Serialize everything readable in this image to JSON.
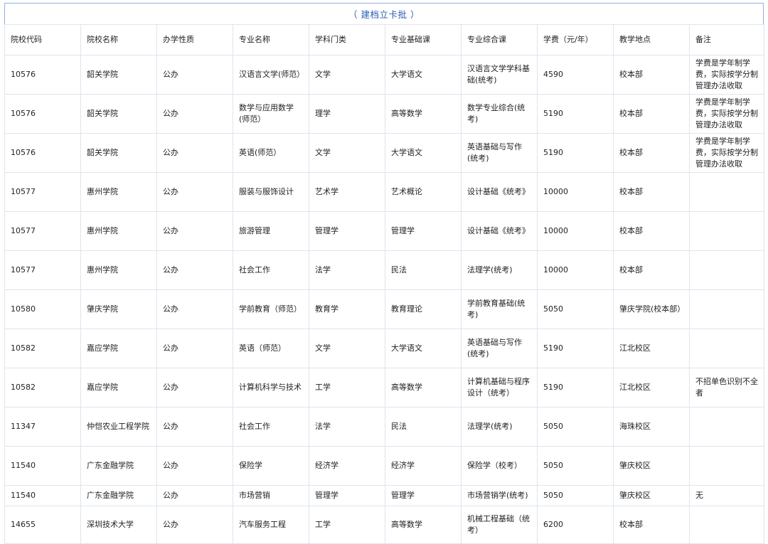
{
  "banner": "（ 建档立卡批 ）",
  "columns": [
    "院校代码",
    "院校名称",
    "办学性质",
    "专业名称",
    "学科门类",
    "专业基础课",
    "专业综合课",
    "学费（元/年）",
    "教学地点",
    "备注"
  ],
  "rows": [
    [
      "10576",
      "韶关学院",
      "公办",
      "汉语言文学(师范）",
      "文学",
      "大学语文",
      "汉语言文学学科基础(统考)",
      "4590",
      "校本部",
      "学费是学年制学费，实际按学分制管理办法收取"
    ],
    [
      "10576",
      "韶关学院",
      "公办",
      "数学与应用数学(师范）",
      "理学",
      "高等数学",
      "数学专业综合(统考)",
      "5190",
      "校本部",
      "学费是学年制学费，实际按学分制管理办法收取"
    ],
    [
      "10576",
      "韶关学院",
      "公办",
      "英语(师范）",
      "文学",
      "大学语文",
      "英语基础与写作(统考)",
      "5190",
      "校本部",
      "学费是学年制学费，实际按学分制管理办法收取"
    ],
    [
      "10577",
      "惠州学院",
      "公办",
      "服装与服饰设计",
      "艺术学",
      "艺术概论",
      "设计基础《统考》",
      "10000",
      "校本部",
      ""
    ],
    [
      "10577",
      "惠州学院",
      "公办",
      "旅游管理",
      "管理学",
      "管理学",
      "设计基础《统考》",
      "10000",
      "校本部",
      ""
    ],
    [
      "10577",
      "惠州学院",
      "公办",
      "社会工作",
      "法学",
      "民法",
      "法理学(统考)",
      "10000",
      "校本部",
      ""
    ],
    [
      "10580",
      "肇庆学院",
      "公办",
      "学前教育（师范）",
      "教育学",
      "教育理论",
      "学前教育基础(统考)",
      "5050",
      "肇庆学院(校本部）",
      ""
    ],
    [
      "10582",
      "嘉应学院",
      "公办",
      "英语（师范）",
      "文学",
      "大学语文",
      "英语基础与写作(统考)",
      "5190",
      "江北校区",
      ""
    ],
    [
      "10582",
      "嘉应学院",
      "公办",
      "计算机科学与技术",
      "工学",
      "高等数学",
      "计算机基础与程序设计（统考）",
      "5190",
      "江北校区",
      "不招单色识别不全者"
    ],
    [
      "11347",
      "仲恺农业工程学院",
      "公办",
      "社会工作",
      "法学",
      "民法",
      "法理学(统考)",
      "5050",
      "海珠校区",
      ""
    ],
    [
      "11540",
      "广东金融学院",
      "公办",
      "保险学",
      "经济学",
      "经济学",
      "保险学（校考）",
      "5050",
      "肇庆校区",
      ""
    ],
    [
      "11540",
      "广东金融学院",
      "公办",
      "市场营销",
      "管理学",
      "管理学",
      "市场营销学(统考)",
      "5050",
      "肇庆校区",
      "无"
    ],
    [
      "14655",
      "深圳技术大学",
      "公办",
      "汽车服务工程",
      "工学",
      "高等数学",
      "机械工程基础（统考）",
      "6200",
      "校本部",
      ""
    ]
  ]
}
